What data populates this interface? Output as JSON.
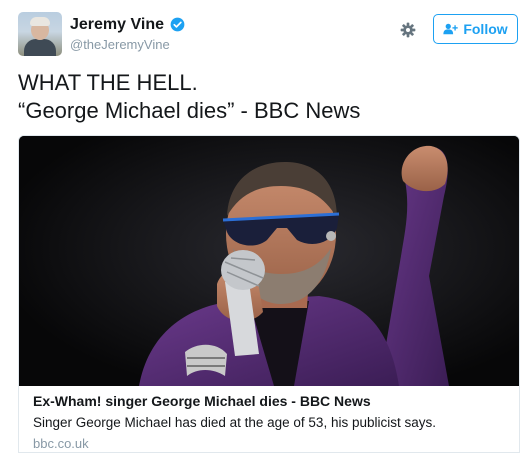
{
  "tweet": {
    "author": {
      "name": "Jeremy Vine",
      "handle": "@theJeremyVine",
      "verified": true
    },
    "follow_label": "Follow",
    "text_lines": [
      "WHAT THE HELL.",
      "“George Michael dies” - BBC News"
    ]
  },
  "card": {
    "title": "Ex-Wham! singer George Michael dies - BBC News",
    "description": "Singer George Michael has died at the age of 53, his publicist says.",
    "domain": "bbc.co.uk"
  },
  "icons": {
    "verified": "verified-badge-icon",
    "gear": "gear-icon",
    "follow": "add-user-icon"
  },
  "colors": {
    "accent": "#1da1f2",
    "text": "#14171a",
    "muted": "#8899a6",
    "border": "#e1e8ed"
  }
}
